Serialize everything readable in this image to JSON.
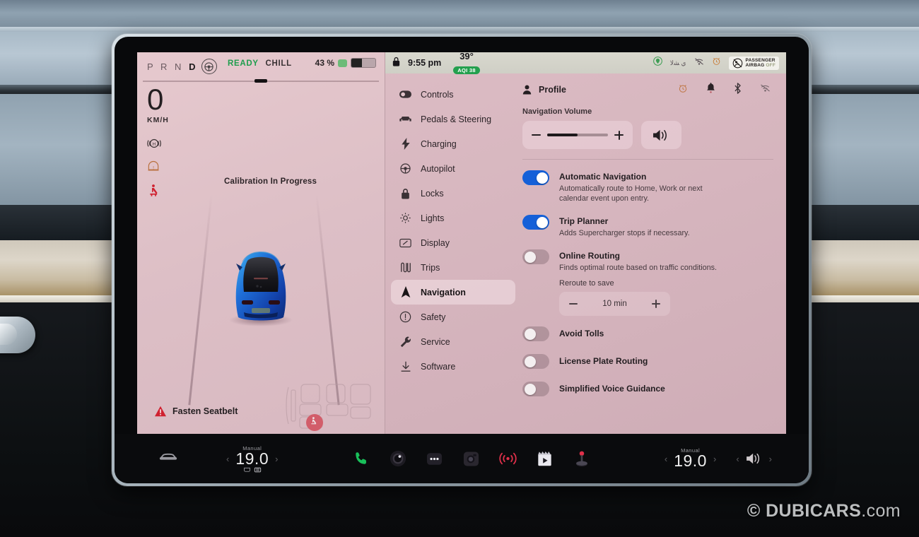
{
  "drive": {
    "gear_inactive": "P R N ",
    "gear_active": "D",
    "wheel_icon": "steering-wheel-icon",
    "status_ready": "READY",
    "status_chill": "CHILL",
    "battery_percent": "43 %",
    "speed": "0",
    "speed_unit": "KM/H",
    "telltales": [
      "parking-brake-hold-icon",
      "tire-pressure-icon",
      "seatbelt-warning-icon"
    ],
    "calibration_message": "Calibration In Progress",
    "fasten_seatbelt": "Fasten Seatbelt"
  },
  "statusbar": {
    "lock_icon": "lock-icon",
    "time": "9:55 pm",
    "temperature": "39°",
    "aqi_badge": "AQI 38",
    "icons": [
      "location-icon",
      "arabic-glyphs",
      "wifi-off-icon",
      "alarm-clock-icon"
    ],
    "airbag_line1": "PASSENGER",
    "airbag_line2": "AIRBAG",
    "airbag_state": "OFF"
  },
  "menu": {
    "items": [
      {
        "label": "Controls",
        "icon": "toggle-icon",
        "active": false
      },
      {
        "label": "Pedals & Steering",
        "icon": "car-front-icon",
        "active": false
      },
      {
        "label": "Charging",
        "icon": "bolt-icon",
        "active": false
      },
      {
        "label": "Autopilot",
        "icon": "steering-wheel-icon",
        "active": false
      },
      {
        "label": "Locks",
        "icon": "lock-icon",
        "active": false
      },
      {
        "label": "Lights",
        "icon": "sun-light-icon",
        "active": false
      },
      {
        "label": "Display",
        "icon": "display-icon",
        "active": false
      },
      {
        "label": "Trips",
        "icon": "trips-icon",
        "active": false
      },
      {
        "label": "Navigation",
        "icon": "navigation-arrow-icon",
        "active": true
      },
      {
        "label": "Safety",
        "icon": "alert-circle-icon",
        "active": false
      },
      {
        "label": "Service",
        "icon": "wrench-icon",
        "active": false
      },
      {
        "label": "Software",
        "icon": "download-icon",
        "active": false
      }
    ]
  },
  "content": {
    "profile_label": "Profile",
    "header_icons": [
      "alarm-clock-icon",
      "bell-icon",
      "bluetooth-icon",
      "wifi-off-icon"
    ],
    "nav_volume_label": "Navigation Volume",
    "nav_volume_percent": 50,
    "speaker_icon": "speaker-waves-icon",
    "options": [
      {
        "title": "Automatic Navigation",
        "desc": "Automatically route to Home, Work or next calendar event upon entry.",
        "on": true
      },
      {
        "title": "Trip Planner",
        "desc": "Adds Supercharger stops if necessary.",
        "on": true
      },
      {
        "title": "Online Routing",
        "desc": "Finds optimal route based on traffic conditions.",
        "on": false
      }
    ],
    "reroute": {
      "label": "Reroute to save",
      "value": "10  min"
    },
    "simple_options": [
      {
        "title": "Avoid Tolls",
        "on": false
      },
      {
        "title": "License Plate Routing",
        "on": false
      },
      {
        "title": "Simplified Voice Guidance",
        "on": false
      }
    ]
  },
  "appbar": {
    "car_icon": "car-icon",
    "driver_climate": {
      "mode": "Manual",
      "temp": "19.0"
    },
    "passenger_climate": {
      "mode": "Manual",
      "temp": "19.0"
    },
    "center_icons": [
      "phone-icon",
      "camera-lens-icon",
      "apps-dots-icon",
      "dashcam-icon",
      "live-broadcast-icon",
      "media-icon",
      "joystick-icon"
    ],
    "volume_icon": "speaker-waves-icon",
    "chevron_left": "‹",
    "chevron_right": "›"
  },
  "watermark": {
    "copyright": "©",
    "brand": "DUBICARS",
    "tld": ".com"
  },
  "colors": {
    "toggle_on": "#1560d8",
    "ready_green": "#1f9d4d",
    "aqi_green": "#23a04e",
    "warning_red": "#cf2130",
    "screen_bg": "#dcbcc4"
  }
}
